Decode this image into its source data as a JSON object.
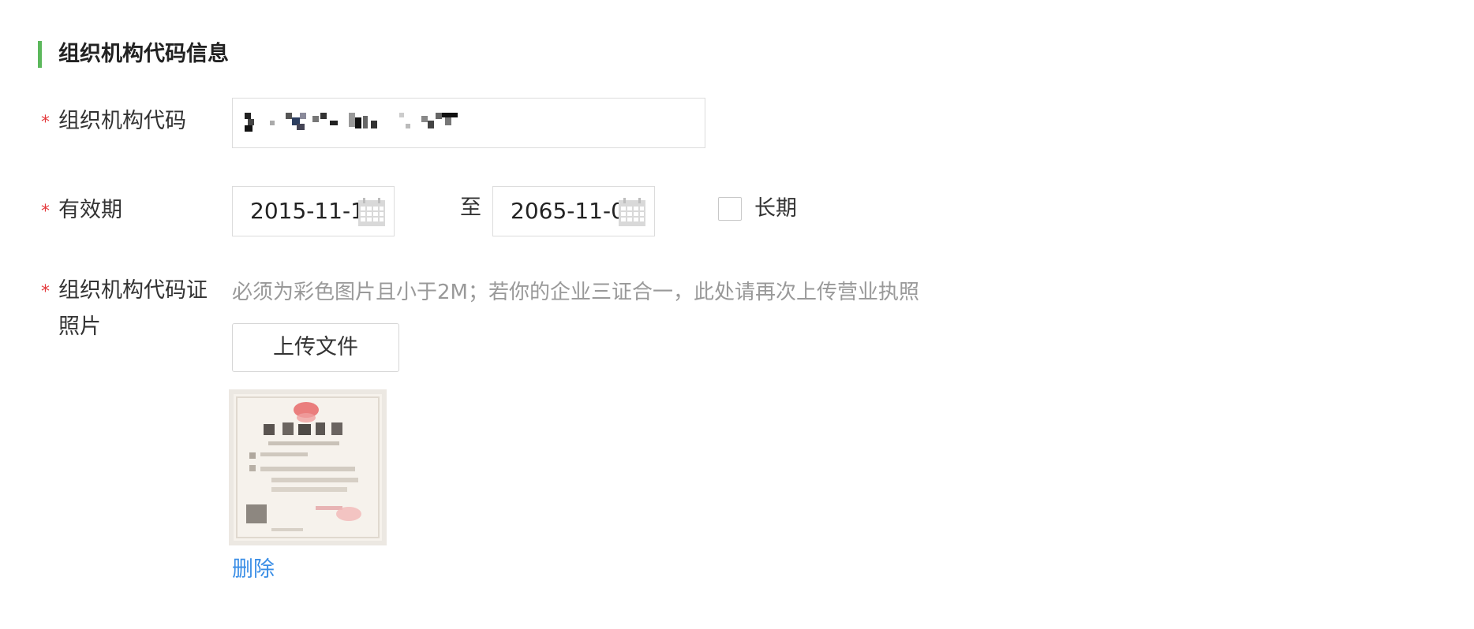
{
  "section": {
    "title": "组织机构代码信息"
  },
  "fields": {
    "org_code": {
      "required_mark": "*",
      "label": "组织机构代码"
    },
    "validity": {
      "required_mark": "*",
      "label": "有效期",
      "start_date": "2015-11-10",
      "separator": "至",
      "end_date": "2065-11-09",
      "long_term_label": "长期",
      "long_term_checked": false
    },
    "certificate": {
      "required_mark": "*",
      "label_line1": "组织机构代码证",
      "label_line2": "照片",
      "hint": "必须为彩色图片且小于2M；若你的企业三证合一，此处请再次上传营业执照",
      "upload_button": "上传文件",
      "delete_link": "删除"
    }
  },
  "colors": {
    "accent_bar": "#5cb85c",
    "required": "#e4393c",
    "link": "#3a8ee6",
    "hint": "#999999",
    "border": "#dcdcdc"
  },
  "icons": [
    "calendar-icon",
    "calendar-icon"
  ]
}
